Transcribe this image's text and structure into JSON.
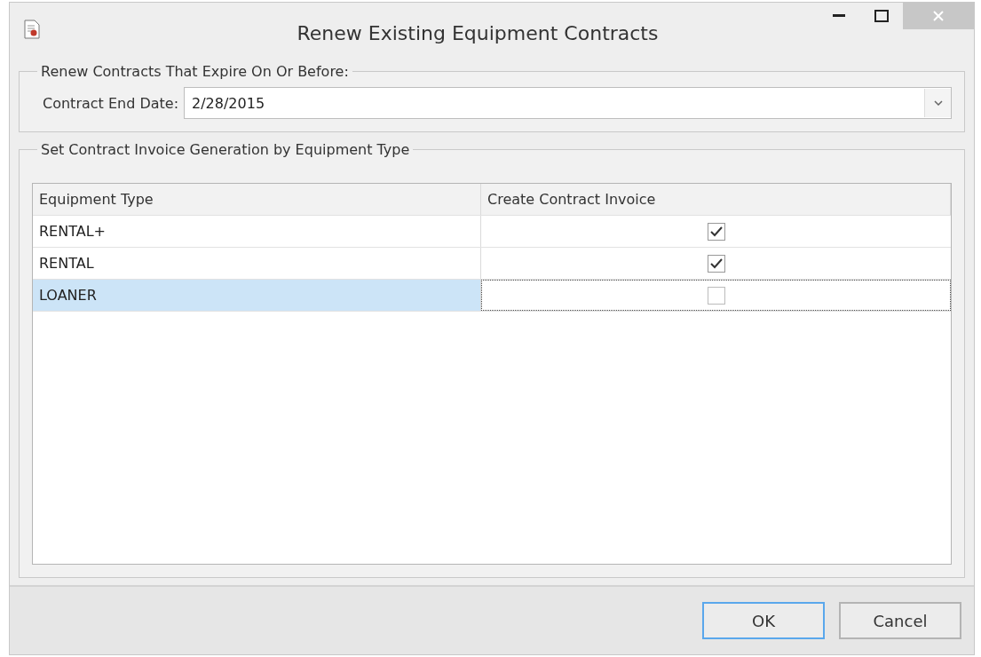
{
  "window": {
    "title": "Renew Existing Equipment Contracts"
  },
  "expiry_group": {
    "legend": "Renew Contracts That Expire On Or Before:",
    "label": "Contract End Date:",
    "value": "2/28/2015"
  },
  "invoice_group": {
    "legend": "Set Contract Invoice Generation by Equipment Type"
  },
  "table": {
    "columns": [
      "Equipment Type",
      "Create Contract Invoice"
    ],
    "rows": [
      {
        "type": "RENTAL+",
        "checked": true,
        "selected": false
      },
      {
        "type": "RENTAL",
        "checked": true,
        "selected": false
      },
      {
        "type": "LOANER",
        "checked": false,
        "selected": true
      }
    ]
  },
  "buttons": [
    {
      "label": "OK",
      "default": true
    },
    {
      "label": "Cancel",
      "default": false
    }
  ]
}
